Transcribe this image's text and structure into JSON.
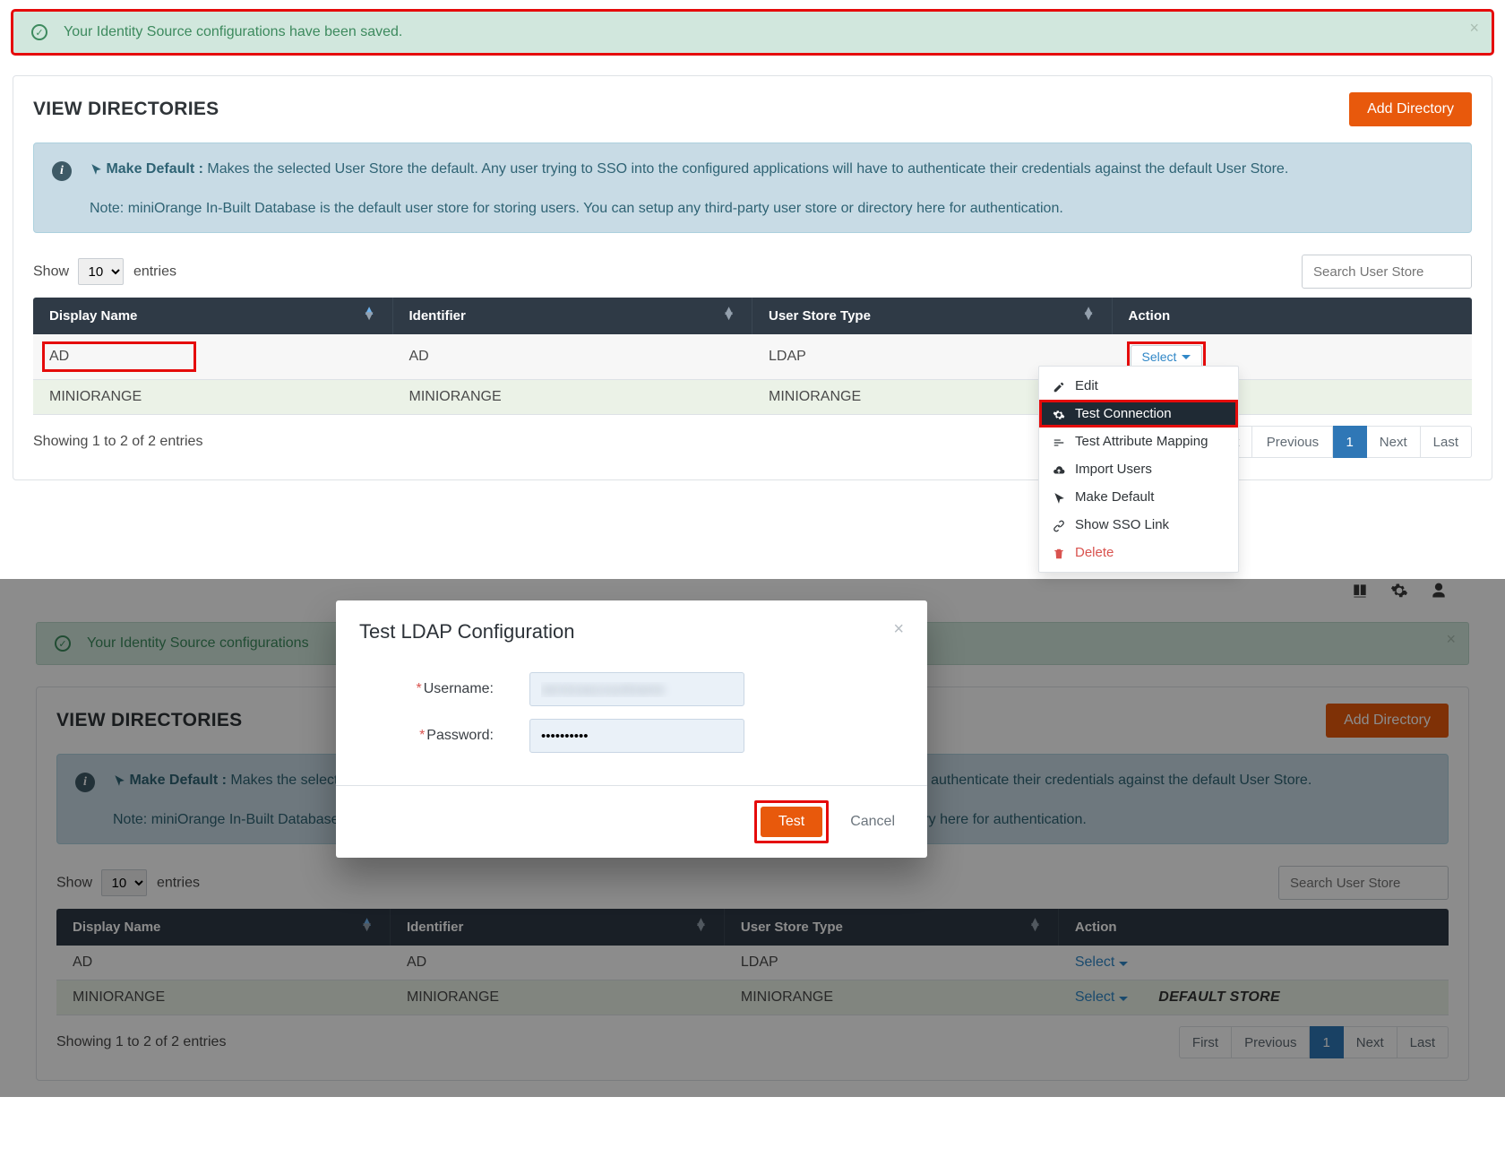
{
  "top": {
    "banner": {
      "text": "Your Identity Source configurations have been saved."
    },
    "header": {
      "title": "VIEW DIRECTORIES",
      "add_btn": "Add Directory"
    },
    "info": {
      "lead_icon": "pointer-icon",
      "lead": "Make Default : ",
      "body": "Makes the selected User Store the default. Any user trying to SSO into the configured applications will have to authenticate their credentials against the default User Store.",
      "note": "Note: miniOrange In-Built Database is the default user store for storing users. You can setup any third-party user store or directory here for authentication."
    },
    "entries": {
      "show": "Show",
      "value": "10",
      "suffix": "entries"
    },
    "search": {
      "placeholder": "Search User Store"
    },
    "columns": {
      "name": "Display Name",
      "identifier": "Identifier",
      "type": "User Store Type",
      "action": "Action"
    },
    "rows": [
      {
        "name": "AD",
        "identifier": "AD",
        "type": "LDAP",
        "select": "Select"
      },
      {
        "name": "MINIORANGE",
        "identifier": "MINIORANGE",
        "type": "MINIORANGE"
      }
    ],
    "showing": "Showing 1 to 2 of 2 entries",
    "pager": {
      "first": "First",
      "prev": "Previous",
      "page": "1",
      "next": "Next",
      "last": "Last"
    },
    "dropdown": {
      "edit": "Edit",
      "test_conn": "Test Connection",
      "test_attr": "Test Attribute Mapping",
      "import": "Import Users",
      "make_default": "Make Default",
      "show_sso": "Show SSO Link",
      "delete": "Delete"
    }
  },
  "bottom": {
    "topbar_icons": {
      "book": "book-icon",
      "gear": "gear-icon",
      "user": "user-icon"
    },
    "banner": {
      "text": "Your Identity Source configurations"
    },
    "header": {
      "title": "VIEW DIRECTORIES",
      "add_btn": "Add Directory"
    },
    "info": {
      "lead": "Make Default : ",
      "body": "Makes the selected User Store the default. Any user trying to SSO into the configured applications will have to authenticate their credentials against the default User Store.",
      "note": "Note: miniOrange In-Built Database is the default user store for storing users. You can setup any third-party user store or directory here for authentication."
    },
    "entries": {
      "show": "Show",
      "value": "10",
      "suffix": "entries"
    },
    "search": {
      "placeholder": "Search User Store"
    },
    "columns": {
      "name": "Display Name",
      "identifier": "Identifier",
      "type": "User Store Type",
      "action": "Action"
    },
    "rows": [
      {
        "name": "AD",
        "identifier": "AD",
        "type": "LDAP",
        "select": "Select"
      },
      {
        "name": "MINIORANGE",
        "identifier": "MINIORANGE",
        "type": "MINIORANGE",
        "select": "Select",
        "badge": "DEFAULT STORE"
      }
    ],
    "showing": "Showing 1 to 2 of 2 entries",
    "pager": {
      "first": "First",
      "prev": "Previous",
      "page": "1",
      "next": "Next",
      "last": "Last"
    },
    "modal": {
      "title": "Test LDAP Configuration",
      "username_label": "Username:",
      "password_label": "Password:",
      "username_value": "serviceaccountname",
      "password_value": "••••••••••",
      "test": "Test",
      "cancel": "Cancel"
    }
  }
}
